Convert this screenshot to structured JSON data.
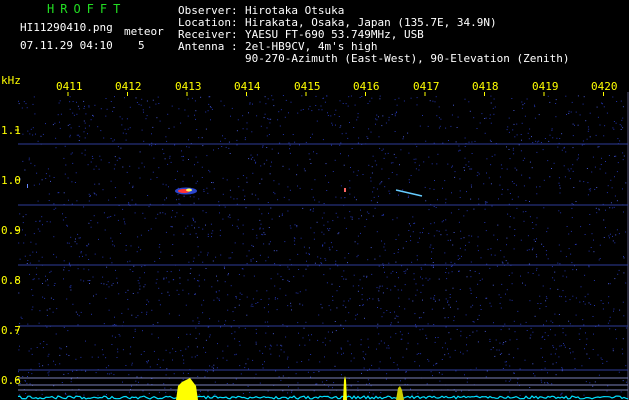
{
  "brand": "HROFFT",
  "file": "HI11290410.png",
  "timestamp": "07.11.29 04:10",
  "meteor_label": "meteor",
  "meteor_count": "5",
  "info": {
    "observer_label": "Observer",
    "observer": "Hirotaka Otsuka",
    "location_label": "Location",
    "location": "Hirakata, Osaka, Japan (135.7E, 34.9N)",
    "receiver_label": "Receiver",
    "receiver": "YAESU FT-690 53.749MHz, USB",
    "antenna_label": "Antenna",
    "antenna": "2el-HB9CV, 4m's high",
    "antenna_line2": "90-270-Azimuth (East-West), 90-Elevation (Zenith)"
  },
  "y_unit": "kHz",
  "y_ticks": [
    "1.1",
    "1.0",
    "0.9",
    "0.8",
    "0.7",
    "0.6"
  ],
  "x_ticks": [
    "0411",
    "0412",
    "0413",
    "0414",
    "0415",
    "0416",
    "0417",
    "0418",
    "0419",
    "0420"
  ],
  "colors": {
    "label": "#ffff00",
    "grid": "#3344aa",
    "noise": "#2233aa",
    "trace": "#00e0ff",
    "signal": "#ffff00"
  }
}
